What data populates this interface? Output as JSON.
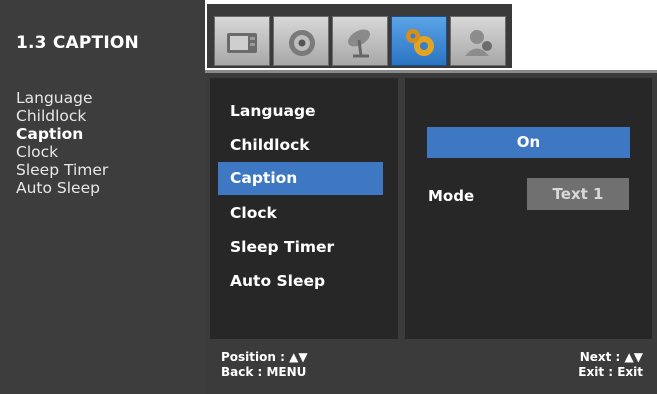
{
  "guide": {
    "title": "1.3 CAPTION",
    "items": [
      "Language",
      "Childlock",
      "Caption",
      "Clock",
      "Sleep Timer",
      "Auto Sleep"
    ]
  },
  "tabs": [
    {
      "icon": "picture-icon"
    },
    {
      "icon": "sound-icon"
    },
    {
      "icon": "channel-icon"
    },
    {
      "icon": "setup-icon",
      "active": true
    },
    {
      "icon": "user-icon"
    }
  ],
  "menu": {
    "items": [
      "Language",
      "Childlock",
      "Caption",
      "Clock",
      "Sleep Timer",
      "Auto Sleep"
    ],
    "selected": "Caption"
  },
  "caption": {
    "state": "On",
    "mode_label": "Mode",
    "mode_value": "Text 1"
  },
  "footer": {
    "position": "Position : ▲▼",
    "back": "Back : MENU",
    "next": "Next : ▲▼",
    "exit": "Exit : Exit"
  },
  "colors": {
    "highlight": "#3f78c2",
    "panel": "#272727",
    "background": "#3b3b3b"
  }
}
